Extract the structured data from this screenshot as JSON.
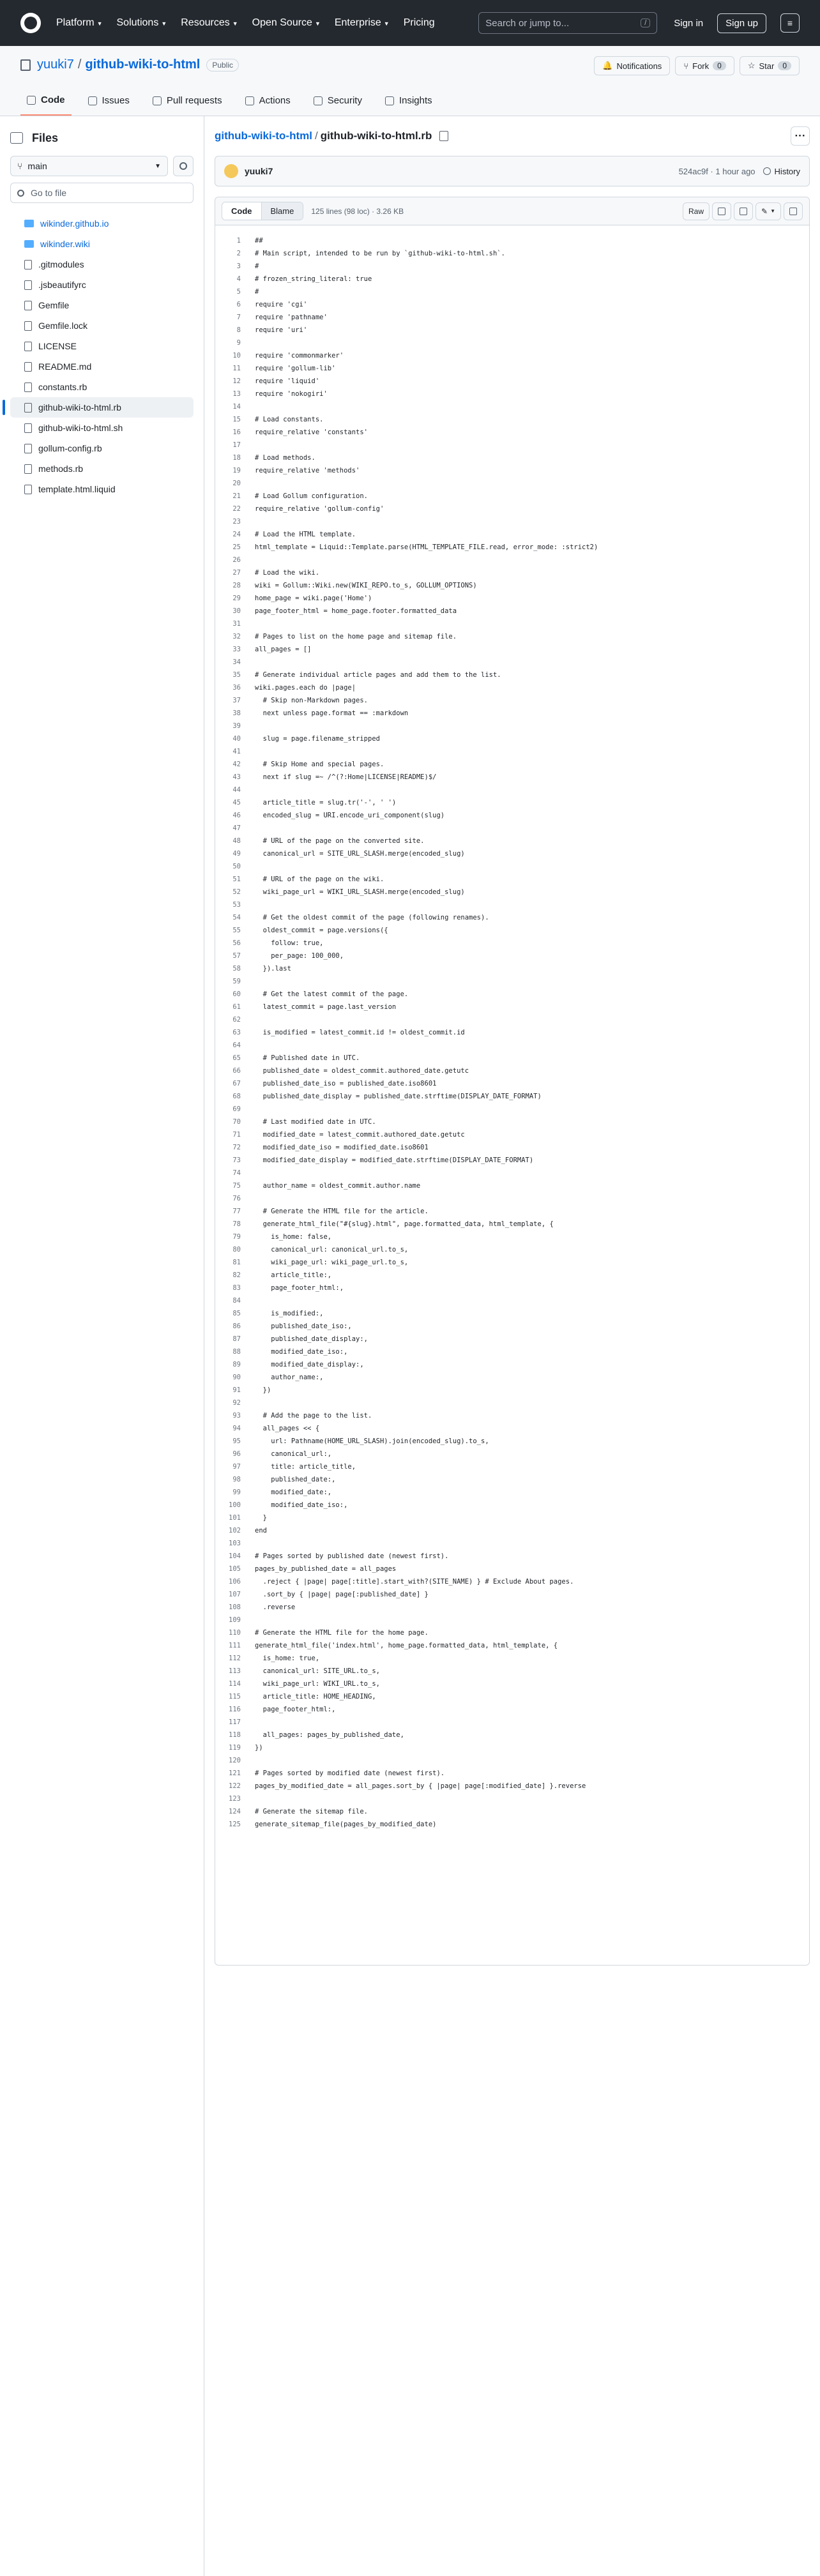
{
  "nav": {
    "items": [
      "Platform",
      "Solutions",
      "Resources",
      "Open Source",
      "Enterprise",
      "Pricing"
    ],
    "search_placeholder": "Search or jump to...",
    "search_key": "/",
    "signin": "Sign in",
    "signup": "Sign up"
  },
  "repo": {
    "owner": "yuuki7",
    "name": "github-wiki-to-html",
    "visibility": "Public",
    "notifications": "Notifications",
    "fork": "Fork",
    "fork_count": "0",
    "star": "Star",
    "star_count": "0"
  },
  "tabs": [
    "Code",
    "Issues",
    "Pull requests",
    "Actions",
    "Security",
    "Insights"
  ],
  "sidebar": {
    "title": "Files",
    "branch": "main",
    "goto_placeholder": "Go to file",
    "items": [
      {
        "label": "wikinder.github.io",
        "type": "submodule"
      },
      {
        "label": "wikinder.wiki",
        "type": "submodule"
      },
      {
        "label": ".gitmodules",
        "type": "file"
      },
      {
        "label": ".jsbeautifyrc",
        "type": "file"
      },
      {
        "label": "Gemfile",
        "type": "file"
      },
      {
        "label": "Gemfile.lock",
        "type": "file"
      },
      {
        "label": "LICENSE",
        "type": "file"
      },
      {
        "label": "README.md",
        "type": "file"
      },
      {
        "label": "constants.rb",
        "type": "file"
      },
      {
        "label": "github-wiki-to-html.rb",
        "type": "file",
        "selected": true
      },
      {
        "label": "github-wiki-to-html.sh",
        "type": "file"
      },
      {
        "label": "gollum-config.rb",
        "type": "file"
      },
      {
        "label": "methods.rb",
        "type": "file"
      },
      {
        "label": "template.html.liquid",
        "type": "file"
      }
    ]
  },
  "breadcrumb": {
    "repo": "github-wiki-to-html",
    "sep": "/",
    "file": "github-wiki-to-html.rb"
  },
  "commit": {
    "author": "yuuki7",
    "meta": "524ac9f · 1 hour ago",
    "history": "History"
  },
  "file": {
    "code_tab": "Code",
    "blame_tab": "Blame",
    "info": "125 lines (98 loc) · 3.26 KB",
    "raw": "Raw"
  },
  "lines": [
    "##",
    "# Main script, intended to be run by `github-wiki-to-html.sh`.",
    "#",
    "# frozen_string_literal: true",
    "#",
    "require 'cgi'",
    "require 'pathname'",
    "require 'uri'",
    "",
    "require 'commonmarker'",
    "require 'gollum-lib'",
    "require 'liquid'",
    "require 'nokogiri'",
    "",
    "# Load constants.",
    "require_relative 'constants'",
    "",
    "# Load methods.",
    "require_relative 'methods'",
    "",
    "# Load Gollum configuration.",
    "require_relative 'gollum-config'",
    "",
    "# Load the HTML template.",
    "html_template = Liquid::Template.parse(HTML_TEMPLATE_FILE.read, error_mode: :strict2)",
    "",
    "# Load the wiki.",
    "wiki = Gollum::Wiki.new(WIKI_REPO.to_s, GOLLUM_OPTIONS)",
    "home_page = wiki.page('Home')",
    "page_footer_html = home_page.footer.formatted_data",
    "",
    "# Pages to list on the home page and sitemap file.",
    "all_pages = []",
    "",
    "# Generate individual article pages and add them to the list.",
    "wiki.pages.each do |page|",
    "  # Skip non-Markdown pages.",
    "  next unless page.format == :markdown",
    "",
    "  slug = page.filename_stripped",
    "",
    "  # Skip Home and special pages.",
    "  next if slug =~ /^(?:Home|LICENSE|README)$/",
    "",
    "  article_title = slug.tr('-', ' ')",
    "  encoded_slug = URI.encode_uri_component(slug)",
    "",
    "  # URL of the page on the converted site.",
    "  canonical_url = SITE_URL_SLASH.merge(encoded_slug)",
    "",
    "  # URL of the page on the wiki.",
    "  wiki_page_url = WIKI_URL_SLASH.merge(encoded_slug)",
    "",
    "  # Get the oldest commit of the page (following renames).",
    "  oldest_commit = page.versions({",
    "    follow: true,",
    "    per_page: 100_000,",
    "  }).last",
    "",
    "  # Get the latest commit of the page.",
    "  latest_commit = page.last_version",
    "",
    "  is_modified = latest_commit.id != oldest_commit.id",
    "",
    "  # Published date in UTC.",
    "  published_date = oldest_commit.authored_date.getutc",
    "  published_date_iso = published_date.iso8601",
    "  published_date_display = published_date.strftime(DISPLAY_DATE_FORMAT)",
    "",
    "  # Last modified date in UTC.",
    "  modified_date = latest_commit.authored_date.getutc",
    "  modified_date_iso = modified_date.iso8601",
    "  modified_date_display = modified_date.strftime(DISPLAY_DATE_FORMAT)",
    "",
    "  author_name = oldest_commit.author.name",
    "",
    "  # Generate the HTML file for the article.",
    "  generate_html_file(\"#{slug}.html\", page.formatted_data, html_template, {",
    "    is_home: false,",
    "    canonical_url: canonical_url.to_s,",
    "    wiki_page_url: wiki_page_url.to_s,",
    "    article_title:,",
    "    page_footer_html:,",
    "",
    "    is_modified:,",
    "    published_date_iso:,",
    "    published_date_display:,",
    "    modified_date_iso:,",
    "    modified_date_display:,",
    "    author_name:,",
    "  })",
    "",
    "  # Add the page to the list.",
    "  all_pages << {",
    "    url: Pathname(HOME_URL_SLASH).join(encoded_slug).to_s,",
    "    canonical_url:,",
    "    title: article_title,",
    "    published_date:,",
    "    modified_date:,",
    "    modified_date_iso:,",
    "  }",
    "end",
    "",
    "# Pages sorted by published date (newest first).",
    "pages_by_published_date = all_pages",
    "  .reject { |page| page[:title].start_with?(SITE_NAME) } # Exclude About pages.",
    "  .sort_by { |page| page[:published_date] }",
    "  .reverse",
    "",
    "# Generate the HTML file for the home page.",
    "generate_html_file('index.html', home_page.formatted_data, html_template, {",
    "  is_home: true,",
    "  canonical_url: SITE_URL.to_s,",
    "  wiki_page_url: WIKI_URL.to_s,",
    "  article_title: HOME_HEADING,",
    "  page_footer_html:,",
    "",
    "  all_pages: pages_by_published_date,",
    "})",
    "",
    "# Pages sorted by modified date (newest first).",
    "pages_by_modified_date = all_pages.sort_by { |page| page[:modified_date] }.reverse",
    "",
    "# Generate the sitemap file.",
    "generate_sitemap_file(pages_by_modified_date)"
  ]
}
